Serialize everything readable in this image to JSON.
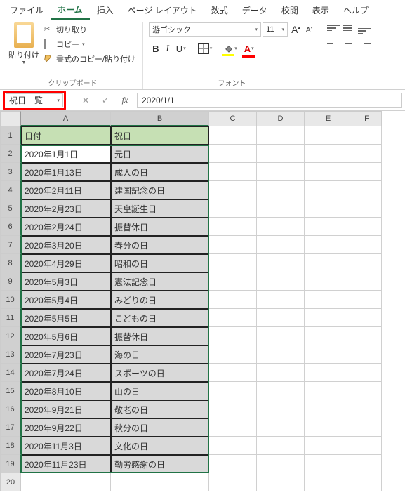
{
  "menu": {
    "file": "ファイル",
    "home": "ホーム",
    "insert": "挿入",
    "page_layout": "ページ レイアウト",
    "formulas": "数式",
    "data": "データ",
    "review": "校閲",
    "view": "表示",
    "help": "ヘルプ"
  },
  "ribbon": {
    "clipboard": {
      "paste": "貼り付け",
      "cut": "切り取り",
      "copy": "コピー",
      "format_painter": "書式のコピー/貼り付け",
      "group_label": "クリップボード"
    },
    "font": {
      "name": "游ゴシック",
      "size": "11",
      "group_label": "フォント",
      "bold": "B",
      "italic": "I",
      "underline": "U"
    }
  },
  "name_box": "祝日一覧",
  "formula_bar": "2020/1/1",
  "columns": [
    "A",
    "B",
    "C",
    "D",
    "E",
    "F"
  ],
  "table": {
    "headers": {
      "date": "日付",
      "holiday": "祝日"
    },
    "rows": [
      {
        "date": "2020年1月1日",
        "holiday": "元日"
      },
      {
        "date": "2020年1月13日",
        "holiday": "成人の日"
      },
      {
        "date": "2020年2月11日",
        "holiday": "建国記念の日"
      },
      {
        "date": "2020年2月23日",
        "holiday": "天皇誕生日"
      },
      {
        "date": "2020年2月24日",
        "holiday": "振替休日"
      },
      {
        "date": "2020年3月20日",
        "holiday": "春分の日"
      },
      {
        "date": "2020年4月29日",
        "holiday": "昭和の日"
      },
      {
        "date": "2020年5月3日",
        "holiday": "憲法記念日"
      },
      {
        "date": "2020年5月4日",
        "holiday": "みどりの日"
      },
      {
        "date": "2020年5月5日",
        "holiday": "こどもの日"
      },
      {
        "date": "2020年5月6日",
        "holiday": "振替休日"
      },
      {
        "date": "2020年7月23日",
        "holiday": "海の日"
      },
      {
        "date": "2020年7月24日",
        "holiday": "スポーツの日"
      },
      {
        "date": "2020年8月10日",
        "holiday": "山の日"
      },
      {
        "date": "2020年9月21日",
        "holiday": "敬老の日"
      },
      {
        "date": "2020年9月22日",
        "holiday": "秋分の日"
      },
      {
        "date": "2020年11月3日",
        "holiday": "文化の日"
      },
      {
        "date": "2020年11月23日",
        "holiday": "勤労感謝の日"
      }
    ]
  }
}
